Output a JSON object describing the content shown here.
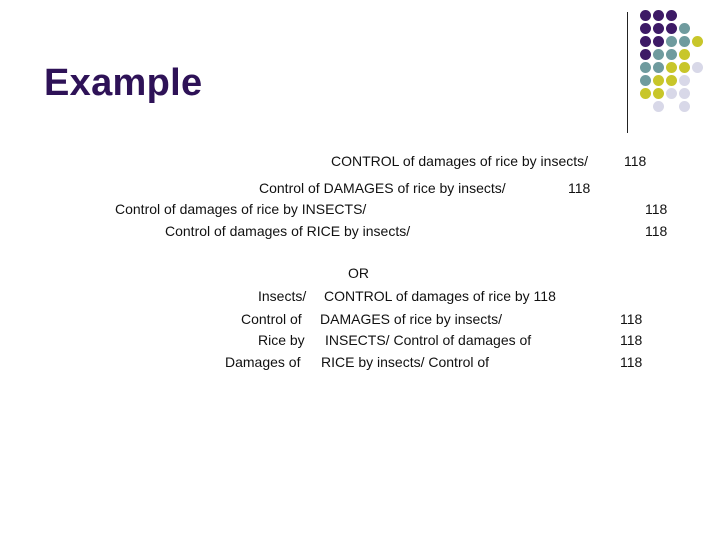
{
  "slide": {
    "title": "Example",
    "colors": {
      "title": "#2e1257",
      "purple": "#3d1a66",
      "teal": "#6f9b9e",
      "yellow": "#c8c62a",
      "lavender": "#d8d8e8"
    },
    "decoration": {
      "dot_grid_rows": [
        [
          "purple",
          "purple",
          "purple",
          "",
          ""
        ],
        [
          "purple",
          "purple",
          "purple",
          "teal",
          ""
        ],
        [
          "purple",
          "purple",
          "teal",
          "teal",
          "yellow"
        ],
        [
          "purple",
          "teal",
          "teal",
          "yellow",
          ""
        ],
        [
          "teal",
          "teal",
          "yellow",
          "yellow",
          "lavender"
        ],
        [
          "teal",
          "yellow",
          "yellow",
          "lavender",
          ""
        ],
        [
          "yellow",
          "yellow",
          "lavender",
          "lavender",
          ""
        ],
        [
          "",
          "lavender",
          "",
          "lavender",
          ""
        ]
      ]
    },
    "block1": [
      {
        "text": "CONTROL of damages of rice by insects/",
        "num": "118"
      },
      {
        "text": "Control of DAMAGES of rice by insects/",
        "num": "118"
      },
      {
        "text": "Control of damages of rice by INSECTS/",
        "num": "118"
      },
      {
        "text": "Control of damages of RICE by insects/",
        "num": "118"
      }
    ],
    "or_label": "OR",
    "block2": [
      {
        "left": "Insects/",
        "right": "CONTROL of damages of rice by 118",
        "num": ""
      },
      {
        "left": "Control of",
        "right": "DAMAGES of rice by insects/",
        "num": "118"
      },
      {
        "left": "Rice by",
        "right": "INSECTS/ Control of damages of",
        "num": "118"
      },
      {
        "left": "Damages of",
        "right": "RICE by insects/ Control of",
        "num": "118"
      }
    ]
  }
}
